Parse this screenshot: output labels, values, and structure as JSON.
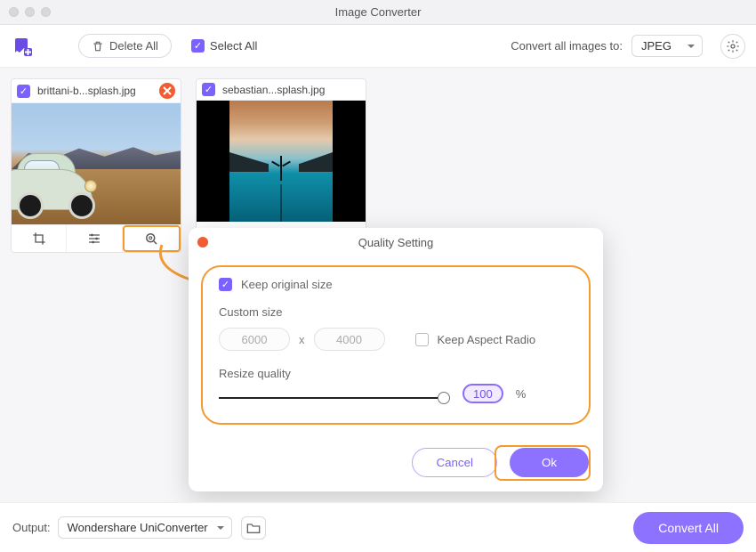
{
  "app": {
    "title": "Image Converter"
  },
  "toolbar": {
    "delete_all": "Delete All",
    "select_all": "Select All",
    "convert_to_label": "Convert all images to:",
    "format": "JPEG"
  },
  "images": [
    {
      "filename": "brittani-b...splash.jpg",
      "checked": true
    },
    {
      "filename": "sebastian...splash.jpg",
      "checked": true
    }
  ],
  "modal": {
    "title": "Quality Setting",
    "keep_original": "Keep original size",
    "custom_size_label": "Custom size",
    "width": "6000",
    "height": "4000",
    "aspect_label": "Keep Aspect Radio",
    "resize_label": "Resize quality",
    "quality": "100",
    "percent": "%",
    "cancel": "Cancel",
    "ok": "Ok"
  },
  "bottombar": {
    "output_label": "Output:",
    "output_path": "Wondershare UniConverter",
    "convert_all": "Convert All"
  }
}
